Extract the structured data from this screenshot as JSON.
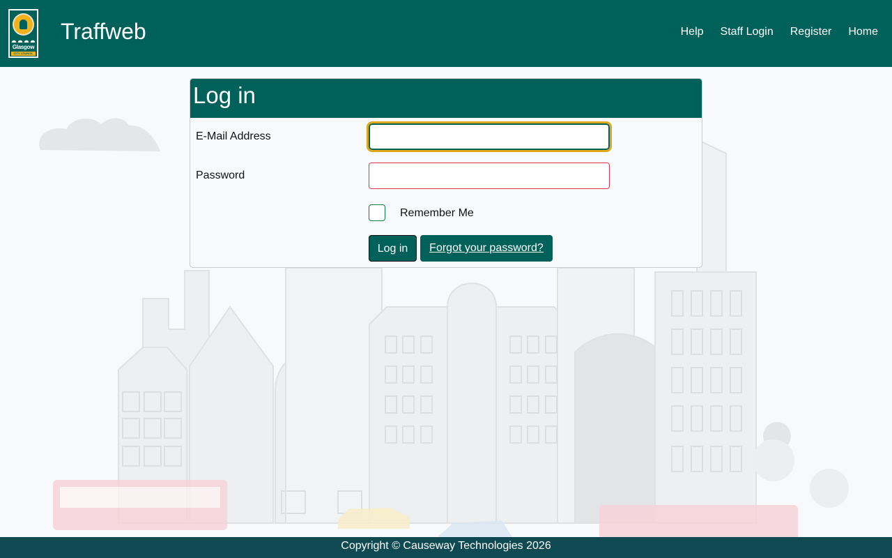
{
  "header": {
    "brand": "Traffweb",
    "logo_text": "Glasgow",
    "logo_subtext": "CITY COUNCIL",
    "nav": [
      {
        "label": "Help"
      },
      {
        "label": "Staff Login"
      },
      {
        "label": "Register"
      },
      {
        "label": "Home"
      }
    ]
  },
  "login": {
    "title": "Log in",
    "email_label": "E-Mail Address",
    "email_value": "",
    "password_label": "Password",
    "password_value": "",
    "remember_label": "Remember Me",
    "remember_checked": false,
    "submit_label": "Log in",
    "forgot_label": "Forgot your password?"
  },
  "footer": {
    "copyright": "Copyright © Causeway Technologies 2026"
  },
  "colors": {
    "brand": "#00605a",
    "footer": "#0f4a52",
    "focus_ring": "#e0a81a",
    "error_border": "#dc3545"
  }
}
